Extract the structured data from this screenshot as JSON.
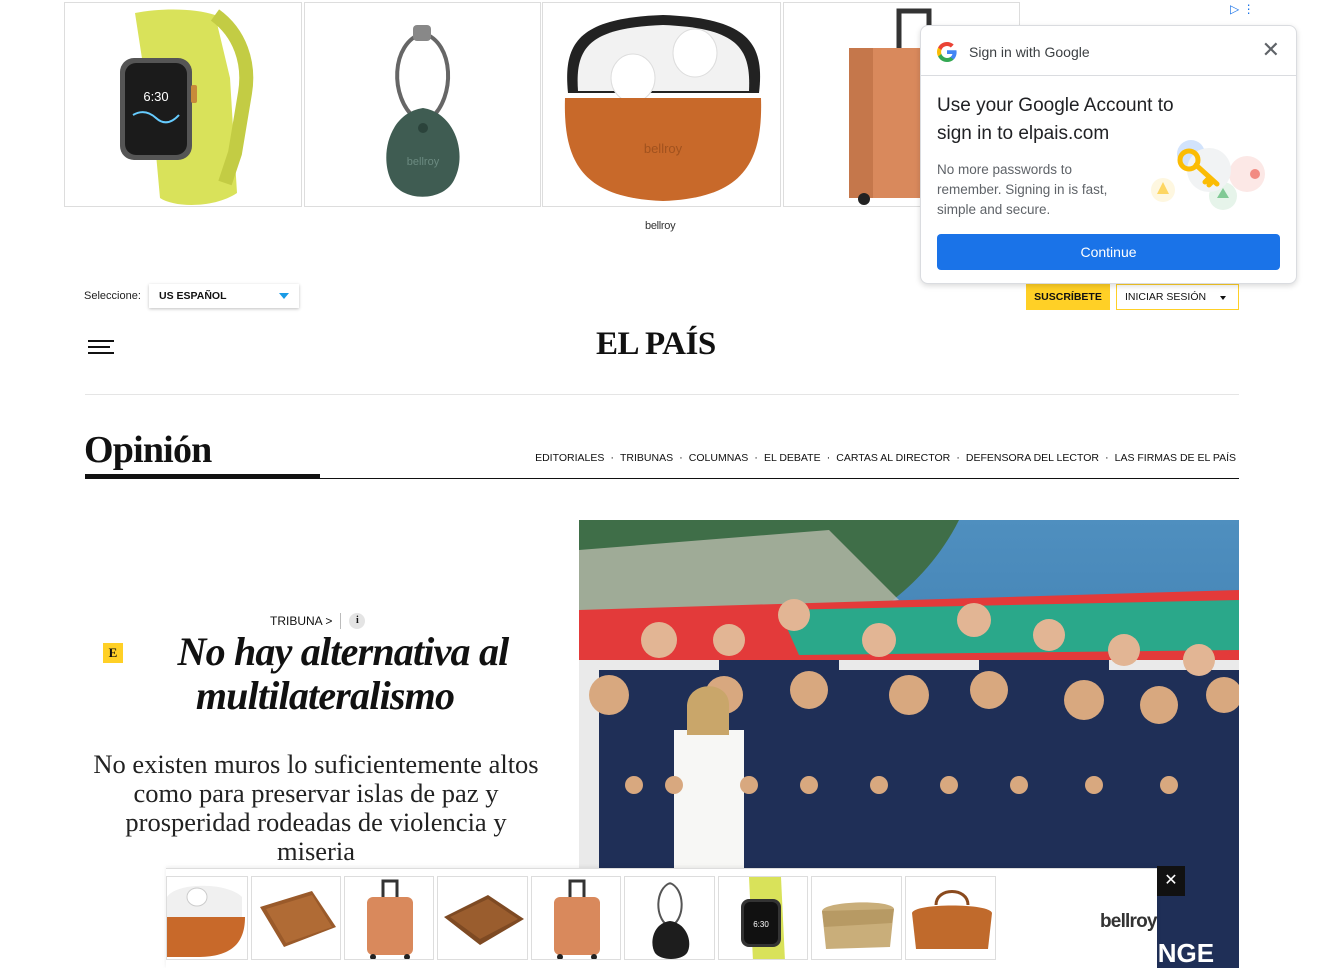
{
  "ad_top": {
    "brand": "bellroy",
    "adchoices": "▷ ⋮",
    "products": [
      "watch-band",
      "tag-keyring",
      "airpods-case",
      "suitcase"
    ]
  },
  "header": {
    "edition_label": "Seleccione:",
    "edition_value": "US ESPAÑOL",
    "subscribe": "SUSCRÍBETE",
    "login": "INICIAR SESIÓN",
    "logo": "EL PAÍS"
  },
  "section": {
    "title": "Opinión",
    "nav": [
      "EDITORIALES",
      "TRIBUNAS",
      "COLUMNAS",
      "EL DEBATE",
      "CARTAS AL DIRECTOR",
      "DEFENSORA DEL LECTOR",
      "LAS FIRMAS DE EL PAÍS"
    ]
  },
  "article": {
    "kicker": "TRIBUNA >",
    "info_icon": "i",
    "badge": "E",
    "headline": "No hay alternativa al multilateralismo",
    "dek": "No existen muros lo suficientemente altos como para preservar islas de paz y prosperidad rodeadas de violencia y miseria"
  },
  "google_signin": {
    "header": "Sign in with Google",
    "title": "Use your Google Account to sign in to elpais.com",
    "body": "No more passwords to remember. Signing in is fast, simple and secure.",
    "button": "Continue",
    "close": "✕"
  },
  "ad_bottom": {
    "brand": "bellroy",
    "close": "✕",
    "products": [
      "airpods-case",
      "wallet",
      "suitcase",
      "wallet",
      "suitcase",
      "tag-keyring",
      "watch-band",
      "messenger-bag",
      "duffel-bag"
    ]
  },
  "colors": {
    "accent_yellow": "#ffd026",
    "google_blue": "#1a73e8",
    "edition_caret": "#1a9be6"
  }
}
